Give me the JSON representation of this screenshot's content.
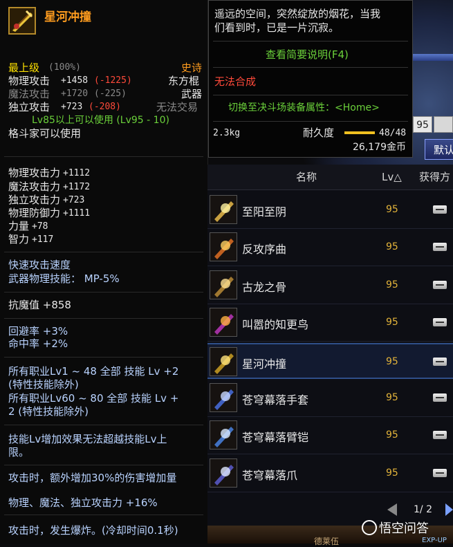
{
  "tooltip": {
    "item_name": "星河冲撞",
    "grade": "最上级",
    "grade_pct": "(100%)",
    "rarity": "史诗",
    "phys_atk_label": "物理攻击",
    "phys_atk_val": "+1458",
    "phys_atk_diff": "(-1225)",
    "weapon_type": "东方棍",
    "mag_atk_label": "魔法攻击",
    "mag_atk_val": "+1720",
    "mag_atk_diff": "(-225)",
    "category": "武器",
    "ind_atk_label": "独立攻击",
    "ind_atk_val": "+723",
    "ind_atk_diff": "(-208)",
    "trade": "无法交易",
    "level_req": "Lv85以上可以使用 (Lv95 - 10)",
    "class_req": "格斗家可以使用",
    "stats": [
      {
        "label": "物理攻击力",
        "val": "+1112"
      },
      {
        "label": "魔法攻击力",
        "val": "+1172"
      },
      {
        "label": "独立攻击力",
        "val": "+723"
      },
      {
        "label": "物理防御力",
        "val": "+1111"
      },
      {
        "label": "力量",
        "val": "+78"
      },
      {
        "label": "智力",
        "val": "+117"
      }
    ],
    "speed": "快速攻击速度",
    "skill_mp": "武器物理技能： MP-5%",
    "demon_resist": "抗魔值 +858",
    "evade": "回避率 +3%",
    "hit": "命中率 +2%",
    "skill1_a": "所有职业Lv1 ~ 48 全部 技能 Lv +2",
    "skill1_b": "(特性技能除外)",
    "skill2_a": "所有职业Lv60 ~ 80 全部 技能 Lv +",
    "skill2_b": "2 (特性技能除外)",
    "skill_note_a": "技能Lv增加效果无法超越技能Lv上",
    "skill_note_b": "限。",
    "dmg_bonus": "攻击时，额外增加30%的伤害增加量",
    "atk_bonus": "物理、魔法、独立攻击力 +16%",
    "explode": "攻击时，发生爆炸。(冷却时间0.1秒)"
  },
  "info": {
    "flavor_a": "遥远的空间，突然绽放的烟花，当我",
    "flavor_b": "们看到时，已是一片沉寂。",
    "brief": "查看简要说明(F4)",
    "cannot_combine": "无法合成",
    "switch_pvp": "切换至决斗场装备属性：<Home>",
    "weight": "2.3kg",
    "durability_label": "耐久度",
    "durability": "48/48",
    "price": "26,179金币"
  },
  "level_input": "95",
  "default_button": "默认",
  "list": {
    "col_name": "名称",
    "col_lv": "Lv△",
    "col_source": "获得方",
    "rows": [
      {
        "name": "至阳至阴",
        "lv": "95"
      },
      {
        "name": "反攻序曲",
        "lv": "95"
      },
      {
        "name": "古龙之骨",
        "lv": "95"
      },
      {
        "name": "叫嚣的知更鸟",
        "lv": "95"
      },
      {
        "name": "星河冲撞",
        "lv": "95"
      },
      {
        "name": "苍穹幕落手套",
        "lv": "95"
      },
      {
        "name": "苍穹幕落臂铠",
        "lv": "95"
      },
      {
        "name": "苍穹幕落爪",
        "lv": "95"
      }
    ]
  },
  "pager": {
    "text": "1/ 2"
  },
  "watermark": "悟空问答",
  "bottom_label": "德莱伍",
  "exp_label": "EXP-UP"
}
